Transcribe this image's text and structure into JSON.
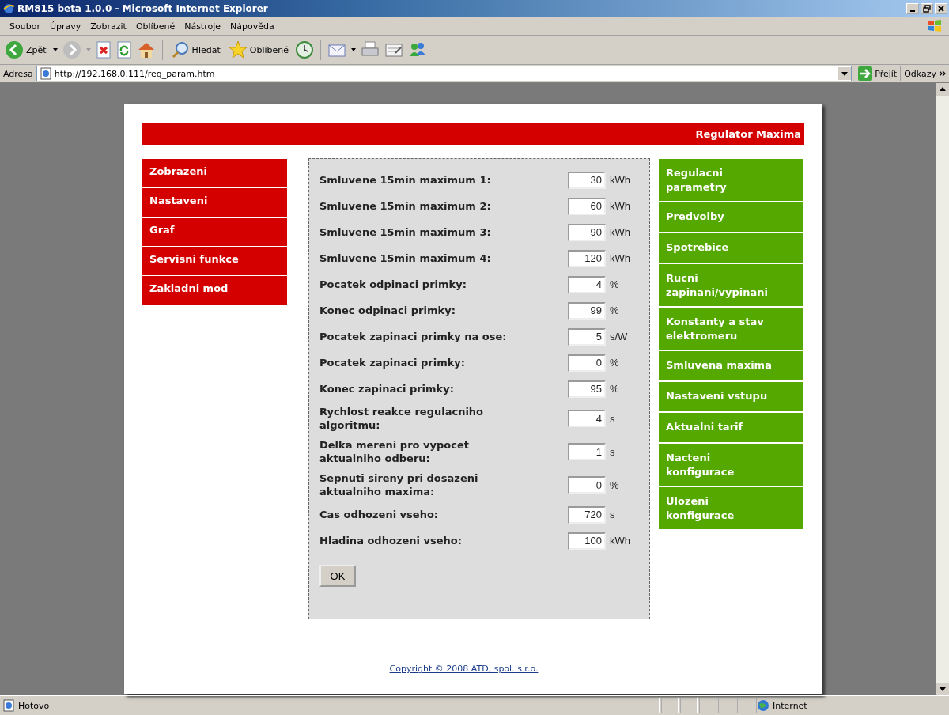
{
  "window": {
    "title": "RM815 beta 1.0.0 - Microsoft Internet Explorer"
  },
  "menu": [
    "Soubor",
    "Úpravy",
    "Zobrazit",
    "Oblíbené",
    "Nástroje",
    "Nápověda"
  ],
  "toolbar": {
    "back": "Zpět",
    "search": "Hledat",
    "favorites": "Oblíbené"
  },
  "address": {
    "label": "Adresa",
    "url": "http://192.168.0.111/reg_param.htm",
    "go": "Přejít",
    "links": "Odkazy"
  },
  "page": {
    "header": "Regulator Maxima",
    "left_nav": [
      {
        "label": "Zobrazeni"
      },
      {
        "label": "Nastaveni"
      },
      {
        "label": "Graf"
      },
      {
        "label": "Servisni funkce"
      },
      {
        "label": "Zakladni mod"
      }
    ],
    "form": {
      "fields": [
        {
          "label": "Smluvene 15min maximum 1:",
          "value": "30",
          "unit": "kWh"
        },
        {
          "label": "Smluvene 15min maximum 2:",
          "value": "60",
          "unit": "kWh"
        },
        {
          "label": "Smluvene 15min maximum 3:",
          "value": "90",
          "unit": "kWh"
        },
        {
          "label": "Smluvene 15min maximum 4:",
          "value": "120",
          "unit": "kWh"
        },
        {
          "label": "Pocatek odpinaci primky:",
          "value": "4",
          "unit": "%"
        },
        {
          "label": "Konec odpinaci primky:",
          "value": "99",
          "unit": "%"
        },
        {
          "label": "Pocatek zapinaci primky na ose:",
          "value": "5",
          "unit": "s/W"
        },
        {
          "label": "Pocatek zapinaci primky:",
          "value": "0",
          "unit": "%"
        },
        {
          "label": "Konec zapinaci primky:",
          "value": "95",
          "unit": "%"
        },
        {
          "label": "Rychlost reakce regulacniho algoritmu:",
          "value": "4",
          "unit": "s"
        },
        {
          "label": "Delka mereni pro vypocet aktualniho odberu:",
          "value": "1",
          "unit": "s"
        },
        {
          "label": "Sepnuti sireny pri dosazeni aktualniho maxima:",
          "value": "0",
          "unit": "%"
        },
        {
          "label": "Cas odhozeni vseho:",
          "value": "720",
          "unit": "s"
        },
        {
          "label": "Hladina odhozeni vseho:",
          "value": "100",
          "unit": "kWh"
        }
      ],
      "submit": "OK"
    },
    "right_nav": [
      {
        "label": "Regulacni parametry"
      },
      {
        "label": "Predvolby"
      },
      {
        "label": "Spotrebice"
      },
      {
        "label": "Rucni zapinani/vypinani"
      },
      {
        "label": "Konstanty a stav elektromeru"
      },
      {
        "label": "Smluvena maxima"
      },
      {
        "label": "Nastaveni vstupu"
      },
      {
        "label": "Aktualni tarif"
      },
      {
        "label": "Nacteni konfigurace"
      },
      {
        "label": "Ulozeni konfigurace"
      }
    ],
    "footer": "Copyright © 2008 ATD, spol. s r.o."
  },
  "status_bar": {
    "text": "Hotovo",
    "zone": "Internet"
  }
}
